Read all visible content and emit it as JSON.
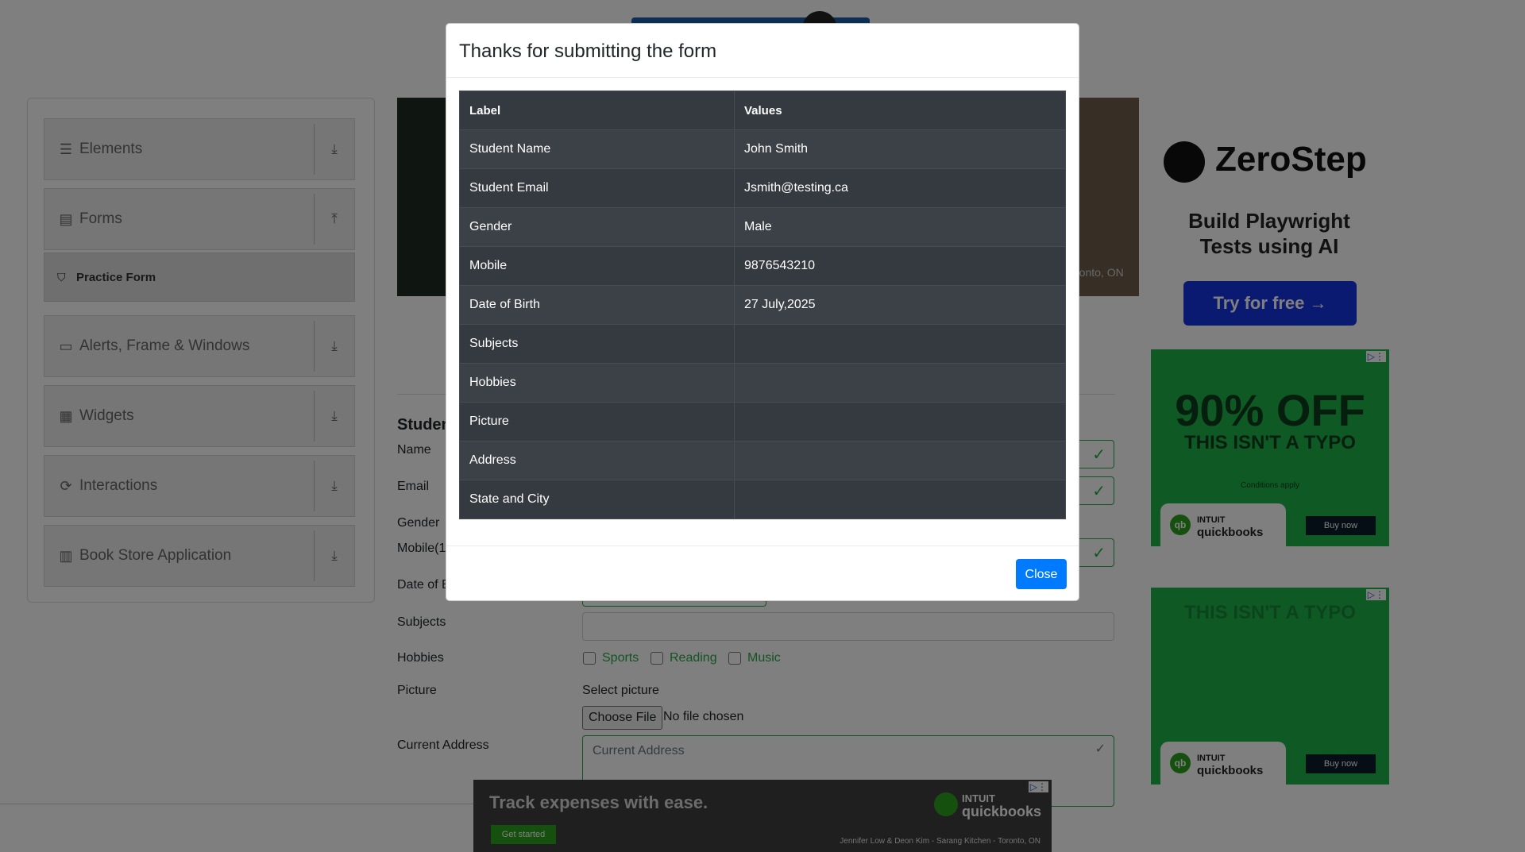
{
  "sidebar": {
    "groups": [
      {
        "label": "Elements",
        "icon": "hamburger-icon",
        "arrow": "down"
      },
      {
        "label": "Forms",
        "icon": "document-icon",
        "arrow": "up"
      },
      {
        "label": "Alerts, Frame & Windows",
        "icon": "window-icon",
        "arrow": "down"
      },
      {
        "label": "Widgets",
        "icon": "grid-icon",
        "arrow": "down"
      },
      {
        "label": "Interactions",
        "icon": "sync-icon",
        "arrow": "down"
      },
      {
        "label": "Book Store Application",
        "icon": "books-icon",
        "arrow": "down"
      }
    ],
    "active_subitem": "Practice Form"
  },
  "banner": {
    "city_fragment": "ronto, ON"
  },
  "form": {
    "heading_fragment": "Studen",
    "labels": {
      "name": "Name",
      "email": "Email",
      "gender": "Gender",
      "mobile": "Mobile(1",
      "dob": "Date of B",
      "subjects": "Subjects",
      "hobbies": "Hobbies",
      "picture": "Picture",
      "address": "Current Address"
    },
    "hobby_options": [
      "Sports",
      "Reading",
      "Music"
    ],
    "picture_prompt": "Select picture",
    "choose_file_label": "Choose File",
    "no_file_text": "No file chosen",
    "address_placeholder": "Current Address"
  },
  "modal": {
    "title": "Thanks for submitting the form",
    "columns": [
      "Label",
      "Values"
    ],
    "rows": [
      {
        "label": "Student Name",
        "value": "John Smith"
      },
      {
        "label": "Student Email",
        "value": "Jsmith@testing.ca"
      },
      {
        "label": "Gender",
        "value": "Male"
      },
      {
        "label": "Mobile",
        "value": "9876543210"
      },
      {
        "label": "Date of Birth",
        "value": "27 July,2025"
      },
      {
        "label": "Subjects",
        "value": ""
      },
      {
        "label": "Hobbies",
        "value": ""
      },
      {
        "label": "Picture",
        "value": ""
      },
      {
        "label": "Address",
        "value": ""
      },
      {
        "label": "State and City",
        "value": ""
      }
    ],
    "close_label": "Close"
  },
  "ads": {
    "zerostep": {
      "name": "ZeroStep",
      "tagline": "Build Playwright Tests using AI",
      "cta": "Try for free →"
    },
    "quickbooks1": {
      "headline": "90% OFF",
      "subhead": "THIS ISN'T A TYPO",
      "conditions": "Conditions apply",
      "brand_top": "INTUIT",
      "brand": "quickbooks",
      "cta": "Buy now"
    },
    "quickbooks2": {
      "subhead": "THIS ISN'T A TYPO",
      "brand_top": "INTUIT",
      "brand": "quickbooks",
      "cta": "Buy now"
    },
    "bottom": {
      "headline": "Track expenses with ease.",
      "cta": "Get started",
      "brand_top": "INTUIT",
      "brand": "quickbooks",
      "caption": "Jennifer Low & Deon Kim - Sarang Kitchen - Toronto, ON"
    }
  },
  "colors": {
    "overlay": "#808080",
    "table_dark": "#343a40",
    "primary": "#007bff",
    "valid_green": "#28a745",
    "ad_green": "#1fb24a"
  }
}
